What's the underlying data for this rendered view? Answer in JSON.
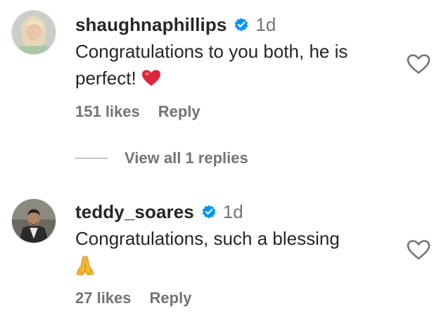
{
  "comments": [
    {
      "username": "shaughnaphillips",
      "verified": true,
      "time": "1d",
      "text": "Congratulations to you both, he is\nperfect! ",
      "emoji": "heart",
      "likes": "151 likes",
      "reply_label": "Reply",
      "avatar_icon": "profile-photo-woman"
    },
    {
      "username": "teddy_soares",
      "verified": true,
      "time": "1d",
      "text": "Congratulations, such a blessing",
      "emoji": "folded-hands",
      "likes": "27 likes",
      "reply_label": "Reply",
      "avatar_icon": "profile-photo-man"
    }
  ],
  "view_replies_label": "View all 1 replies",
  "colors": {
    "text": "#262626",
    "secondary": "#737373",
    "verified_blue": "#0095f6",
    "heart_red": "#ed4956",
    "divider": "#c7c7c7"
  },
  "icons": [
    "verified-badge-icon",
    "heart-outline-icon",
    "red-heart-emoji-icon",
    "folded-hands-emoji-icon"
  ]
}
